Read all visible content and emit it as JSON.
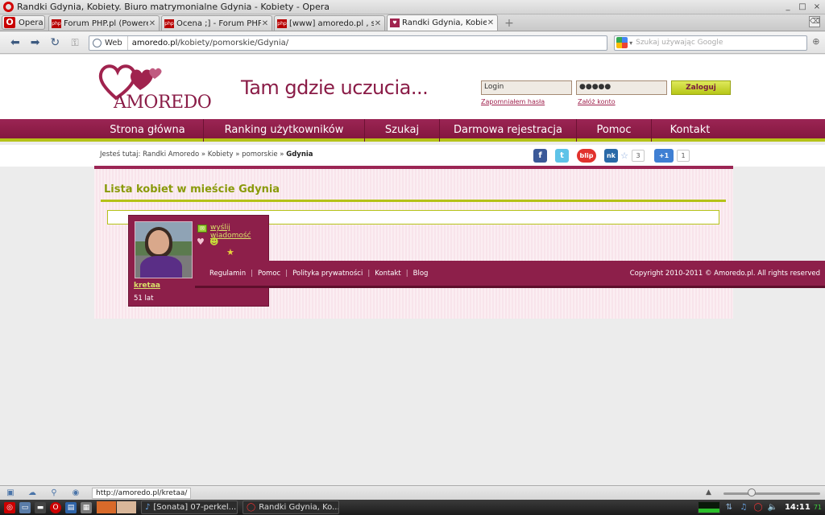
{
  "window": {
    "title": "Randki Gdynia, Kobiety. Biuro matrymonialne Gdynia - Kobiety - Opera",
    "controls": [
      "_",
      "□",
      "×"
    ]
  },
  "tabs": {
    "menu_label": "Opera",
    "items": [
      {
        "label": "Forum PHP.pl (Powered ..."
      },
      {
        "label": "Ocena ;] - Forum PHP.pl"
      },
      {
        "label": "[www] amoredo.pl , ser..."
      },
      {
        "label": "Randki Gdynia, Kobiety. ..."
      }
    ],
    "new_tab": "+"
  },
  "toolbar": {
    "web_label": "Web",
    "url_domain": "amoredo.pl",
    "url_path": "/kobiety/pomorskie/Gdynia/",
    "search_placeholder": "Szukaj używając Google"
  },
  "site": {
    "logo_text": "AMOREDO",
    "slogan": "Tam gdzie uczucia...",
    "login_value": "Login",
    "password_value": "●●●●●",
    "login_button": "Zaloguj",
    "forgot_password": "Zapomniałem hasła",
    "register_link": "Załóż konto",
    "nav": [
      {
        "label": "Strona główna"
      },
      {
        "label": "Ranking użytkowników"
      },
      {
        "label": "Szukaj"
      },
      {
        "label": "Darmowa rejestracja"
      },
      {
        "label": "Pomoc"
      },
      {
        "label": "Kontakt"
      }
    ],
    "breadcrumb_prefix": "Jesteś tutaj:",
    "breadcrumb_items": "Randki Amoredo » Kobiety » pomorskie »",
    "breadcrumb_current": "Gdynia",
    "social": {
      "facebook": "f",
      "twitter": "t",
      "blip": "blip",
      "nk": "nk",
      "nk_count": "3",
      "gplus": "+1",
      "gplus_count": "1"
    },
    "list_title": "Lista kobiet w mieście Gdynia",
    "profile": {
      "send_message": "wyślij wiadomość",
      "nickname": "kretaa",
      "age": "51 lat"
    },
    "footer": {
      "links": [
        "Regulamin",
        "Pomoc",
        "Polityka prywatności",
        "Kontakt",
        "Blog"
      ],
      "copyright": "Copyright 2010-2011 © Amoredo.pl. All rights reserved"
    }
  },
  "status": {
    "url": "http://amoredo.pl/kretaa/"
  },
  "taskbar": {
    "tasks": [
      {
        "label": "[Sonata] 07-perkel..."
      },
      {
        "label": "Randki Gdynia, Ko..."
      }
    ],
    "clock": "14:11",
    "indicator": "71"
  },
  "colors": {
    "brand": "#8d1f4a",
    "accent": "#b5c218",
    "title_green": "#8a9a0a"
  }
}
